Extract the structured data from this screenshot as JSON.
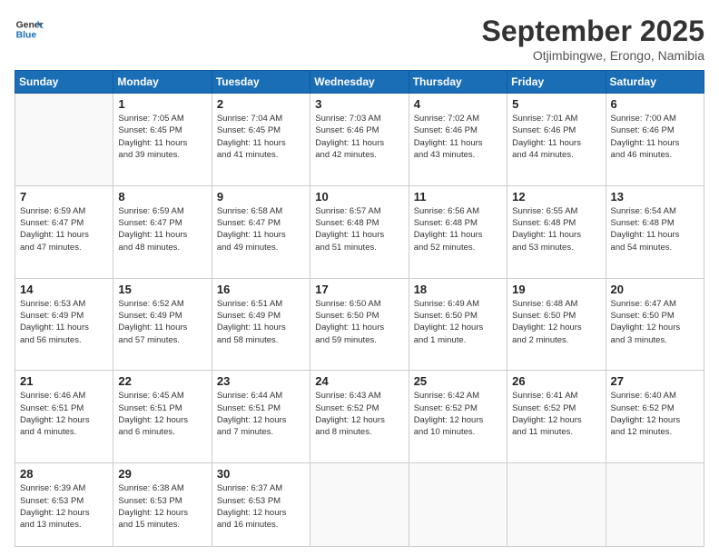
{
  "header": {
    "logo_line1": "General",
    "logo_line2": "Blue",
    "month": "September 2025",
    "location": "Otjimbingwe, Erongo, Namibia"
  },
  "weekdays": [
    "Sunday",
    "Monday",
    "Tuesday",
    "Wednesday",
    "Thursday",
    "Friday",
    "Saturday"
  ],
  "weeks": [
    [
      {
        "day": "",
        "info": ""
      },
      {
        "day": "1",
        "info": "Sunrise: 7:05 AM\nSunset: 6:45 PM\nDaylight: 11 hours\nand 39 minutes."
      },
      {
        "day": "2",
        "info": "Sunrise: 7:04 AM\nSunset: 6:45 PM\nDaylight: 11 hours\nand 41 minutes."
      },
      {
        "day": "3",
        "info": "Sunrise: 7:03 AM\nSunset: 6:46 PM\nDaylight: 11 hours\nand 42 minutes."
      },
      {
        "day": "4",
        "info": "Sunrise: 7:02 AM\nSunset: 6:46 PM\nDaylight: 11 hours\nand 43 minutes."
      },
      {
        "day": "5",
        "info": "Sunrise: 7:01 AM\nSunset: 6:46 PM\nDaylight: 11 hours\nand 44 minutes."
      },
      {
        "day": "6",
        "info": "Sunrise: 7:00 AM\nSunset: 6:46 PM\nDaylight: 11 hours\nand 46 minutes."
      }
    ],
    [
      {
        "day": "7",
        "info": "Sunrise: 6:59 AM\nSunset: 6:47 PM\nDaylight: 11 hours\nand 47 minutes."
      },
      {
        "day": "8",
        "info": "Sunrise: 6:59 AM\nSunset: 6:47 PM\nDaylight: 11 hours\nand 48 minutes."
      },
      {
        "day": "9",
        "info": "Sunrise: 6:58 AM\nSunset: 6:47 PM\nDaylight: 11 hours\nand 49 minutes."
      },
      {
        "day": "10",
        "info": "Sunrise: 6:57 AM\nSunset: 6:48 PM\nDaylight: 11 hours\nand 51 minutes."
      },
      {
        "day": "11",
        "info": "Sunrise: 6:56 AM\nSunset: 6:48 PM\nDaylight: 11 hours\nand 52 minutes."
      },
      {
        "day": "12",
        "info": "Sunrise: 6:55 AM\nSunset: 6:48 PM\nDaylight: 11 hours\nand 53 minutes."
      },
      {
        "day": "13",
        "info": "Sunrise: 6:54 AM\nSunset: 6:48 PM\nDaylight: 11 hours\nand 54 minutes."
      }
    ],
    [
      {
        "day": "14",
        "info": "Sunrise: 6:53 AM\nSunset: 6:49 PM\nDaylight: 11 hours\nand 56 minutes."
      },
      {
        "day": "15",
        "info": "Sunrise: 6:52 AM\nSunset: 6:49 PM\nDaylight: 11 hours\nand 57 minutes."
      },
      {
        "day": "16",
        "info": "Sunrise: 6:51 AM\nSunset: 6:49 PM\nDaylight: 11 hours\nand 58 minutes."
      },
      {
        "day": "17",
        "info": "Sunrise: 6:50 AM\nSunset: 6:50 PM\nDaylight: 11 hours\nand 59 minutes."
      },
      {
        "day": "18",
        "info": "Sunrise: 6:49 AM\nSunset: 6:50 PM\nDaylight: 12 hours\nand 1 minute."
      },
      {
        "day": "19",
        "info": "Sunrise: 6:48 AM\nSunset: 6:50 PM\nDaylight: 12 hours\nand 2 minutes."
      },
      {
        "day": "20",
        "info": "Sunrise: 6:47 AM\nSunset: 6:50 PM\nDaylight: 12 hours\nand 3 minutes."
      }
    ],
    [
      {
        "day": "21",
        "info": "Sunrise: 6:46 AM\nSunset: 6:51 PM\nDaylight: 12 hours\nand 4 minutes."
      },
      {
        "day": "22",
        "info": "Sunrise: 6:45 AM\nSunset: 6:51 PM\nDaylight: 12 hours\nand 6 minutes."
      },
      {
        "day": "23",
        "info": "Sunrise: 6:44 AM\nSunset: 6:51 PM\nDaylight: 12 hours\nand 7 minutes."
      },
      {
        "day": "24",
        "info": "Sunrise: 6:43 AM\nSunset: 6:52 PM\nDaylight: 12 hours\nand 8 minutes."
      },
      {
        "day": "25",
        "info": "Sunrise: 6:42 AM\nSunset: 6:52 PM\nDaylight: 12 hours\nand 10 minutes."
      },
      {
        "day": "26",
        "info": "Sunrise: 6:41 AM\nSunset: 6:52 PM\nDaylight: 12 hours\nand 11 minutes."
      },
      {
        "day": "27",
        "info": "Sunrise: 6:40 AM\nSunset: 6:52 PM\nDaylight: 12 hours\nand 12 minutes."
      }
    ],
    [
      {
        "day": "28",
        "info": "Sunrise: 6:39 AM\nSunset: 6:53 PM\nDaylight: 12 hours\nand 13 minutes."
      },
      {
        "day": "29",
        "info": "Sunrise: 6:38 AM\nSunset: 6:53 PM\nDaylight: 12 hours\nand 15 minutes."
      },
      {
        "day": "30",
        "info": "Sunrise: 6:37 AM\nSunset: 6:53 PM\nDaylight: 12 hours\nand 16 minutes."
      },
      {
        "day": "",
        "info": ""
      },
      {
        "day": "",
        "info": ""
      },
      {
        "day": "",
        "info": ""
      },
      {
        "day": "",
        "info": ""
      }
    ]
  ]
}
